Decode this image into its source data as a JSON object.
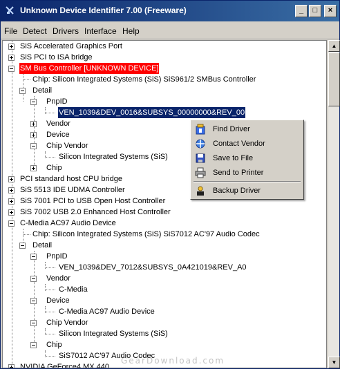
{
  "window": {
    "title": "Unknown Device Identifier 7.00 (Freeware)"
  },
  "menubar": [
    "File",
    "Detect",
    "Drivers",
    "Interface",
    "Help"
  ],
  "tree": {
    "r01": "SiS Accelerated Graphics Port",
    "r02": "SiS PCI to ISA bridge",
    "r03": "SM Bus Controller [UNKNOWN DEVICE]",
    "r04": "Chip: Silicon Integrated Systems (SiS)  SiS961/2 SMBus Controller",
    "r05": "Detail",
    "r06": "PnpID",
    "r07": "VEN_1039&DEV_0016&SUBSYS_00000000&REV_00",
    "r08": "Vendor",
    "r09": "Device",
    "r10": "Chip Vendor",
    "r11": "Silicon Integrated Systems (SiS)",
    "r12": "Chip",
    "r13": "PCI standard host CPU bridge",
    "r14": "SiS 5513 IDE UDMA Controller",
    "r15": "SiS 7001 PCI to USB Open Host Controller",
    "r16": "SiS 7002 USB 2.0 Enhanced Host Controller",
    "r17": "C-Media AC97 Audio Device",
    "r18": "Chip: Silicon Integrated Systems (SiS)  SiS7012 AC'97 Audio Codec",
    "r19": "Detail",
    "r20": "PnpID",
    "r21": "VEN_1039&DEV_7012&SUBSYS_0A421019&REV_A0",
    "r22": "Vendor",
    "r23": "C-Media",
    "r24": "Device",
    "r25": "C-Media AC97 Audio Device",
    "r26": "Chip Vendor",
    "r27": "Silicon Integrated Systems (SiS)",
    "r28": "Chip",
    "r29": "SiS7012 AC'97 Audio Codec",
    "r30": "NVIDIA GeForce4 MX 440"
  },
  "context_menu": {
    "find_driver": "Find Driver",
    "contact_vendor": "Contact Vendor",
    "save_to_file": "Save to File",
    "send_to_printer": "Send to Printer",
    "backup_driver": "Backup Driver"
  },
  "watermark": "GearDownload.com",
  "colors": {
    "unknown_device": "#ff0000",
    "selection": "#0a246a",
    "titlebar": "#0a246a"
  }
}
